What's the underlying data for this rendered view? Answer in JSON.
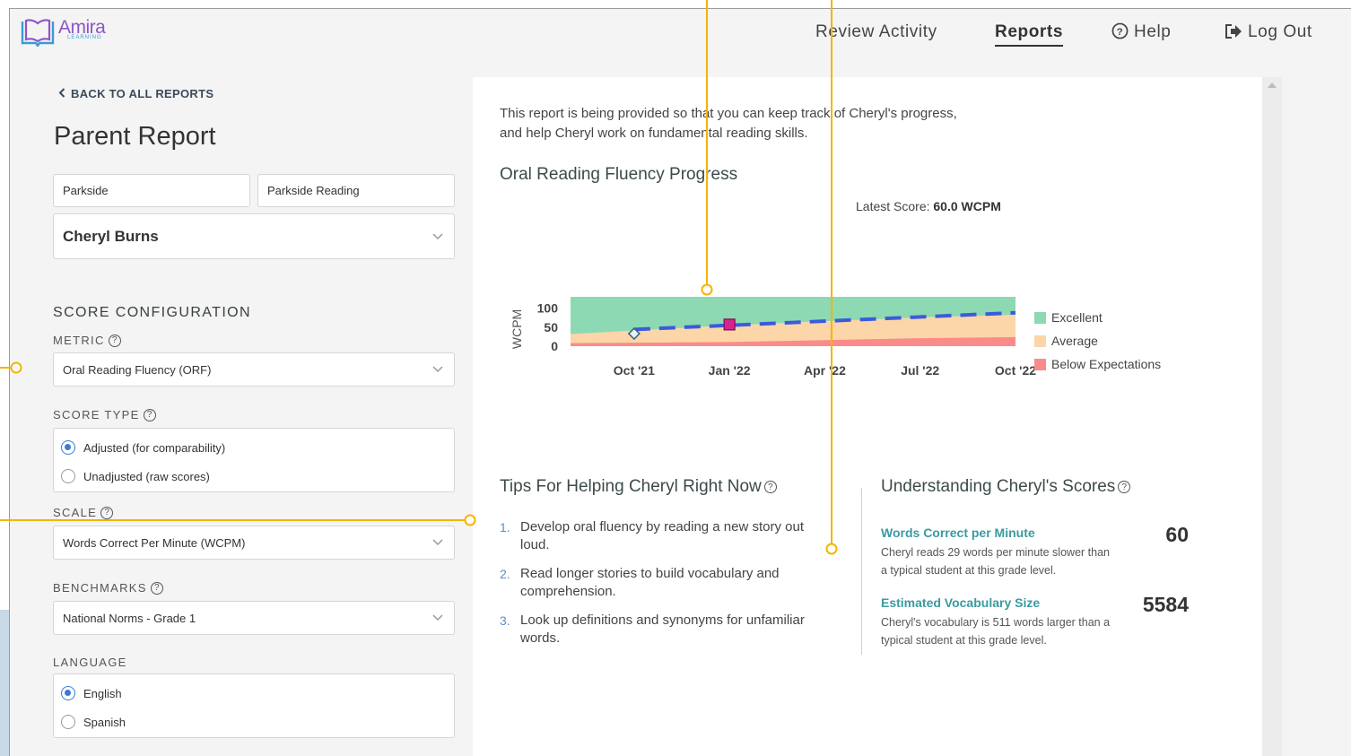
{
  "app": {
    "logo_text": "Amira",
    "logo_sub": "LEARNING",
    "nav": {
      "review": "Review Activity",
      "reports": "Reports",
      "help": "Help",
      "logout": "Log Out"
    }
  },
  "left_panel": {
    "back_link": "BACK TO ALL REPORTS",
    "title": "Parent Report",
    "school": "Parkside",
    "class": "Parkside Reading",
    "student": "Cheryl Burns",
    "score_config_title": "SCORE CONFIGURATION",
    "metric_label": "METRIC",
    "metric_value": "Oral Reading Fluency (ORF)",
    "score_type_label": "SCORE TYPE",
    "score_type_options": [
      "Adjusted (for comparability)",
      "Unadjusted (raw scores)"
    ],
    "scale_label": "SCALE",
    "scale_value": "Words Correct Per Minute (WCPM)",
    "benchmarks_label": "BENCHMARKS",
    "benchmarks_value": "National Norms - Grade 1",
    "language_label": "LANGUAGE",
    "language_options": [
      "English",
      "Spanish"
    ]
  },
  "report": {
    "intro_line1": "This report is being provided so that you can keep track of Cheryl's progress,",
    "intro_line2": "and help Cheryl work on fundamental reading skills.",
    "chart_title": "Oral Reading Fluency Progress",
    "latest_label": "Latest Score:",
    "latest_value": "60.0 WCPM",
    "tips_title": "Tips For Helping Cheryl Right Now",
    "tips": [
      "Develop oral fluency by reading a new story out loud.",
      "Read longer stories to build vocabulary and comprehension.",
      "Look up definitions and synonyms for unfamiliar words."
    ],
    "understanding_title": "Understanding Cheryl's Scores",
    "metrics": [
      {
        "name": "Words Correct per Minute",
        "desc": "Cheryl reads 29 words per minute slower than a typical student at this grade level.",
        "value": "60"
      },
      {
        "name": "Estimated Vocabulary Size",
        "desc": "Cheryl's vocabulary is 511 words larger than a typical student at this grade level.",
        "value": "5584"
      }
    ]
  },
  "colors": {
    "excellent": "#8dd9b3",
    "average": "#fcd6a8",
    "below": "#fa8b8b",
    "trend": "#3b5bdb",
    "marker": "#d6248f",
    "callout": "#f5b400"
  },
  "chart_data": {
    "type": "area",
    "title": "Oral Reading Fluency Progress",
    "ylabel": "WCPM",
    "xlabel": "",
    "ylim": [
      0,
      130
    ],
    "yticks": [
      0,
      50,
      100
    ],
    "x_ticks": [
      "Oct '21",
      "Jan '22",
      "Apr '22",
      "Jul '22",
      "Oct '22"
    ],
    "legend": [
      "Excellent",
      "Average",
      "Below Expectations"
    ],
    "legend_position": "right",
    "bands": {
      "below_upper": [
        {
          "x": "2021-08",
          "y": 8
        },
        {
          "x": "2022-01",
          "y": 11
        },
        {
          "x": "2022-04",
          "y": 16
        },
        {
          "x": "2022-07",
          "y": 21
        },
        {
          "x": "2022-10",
          "y": 24
        }
      ],
      "average_upper": [
        {
          "x": "2021-08",
          "y": 32
        },
        {
          "x": "2022-01",
          "y": 55
        },
        {
          "x": "2022-04",
          "y": 66
        },
        {
          "x": "2022-07",
          "y": 76
        },
        {
          "x": "2022-10",
          "y": 83
        }
      ],
      "excellent_upper": 130
    },
    "trend": [
      {
        "x": "2021-10",
        "y": 44
      },
      {
        "x": "2022-10",
        "y": 88
      }
    ],
    "points": [
      {
        "x": "2021-10",
        "y": 33,
        "shape": "diamond"
      },
      {
        "x": "2022-01",
        "y": 57,
        "shape": "square"
      }
    ],
    "latest_score": 60.0
  }
}
